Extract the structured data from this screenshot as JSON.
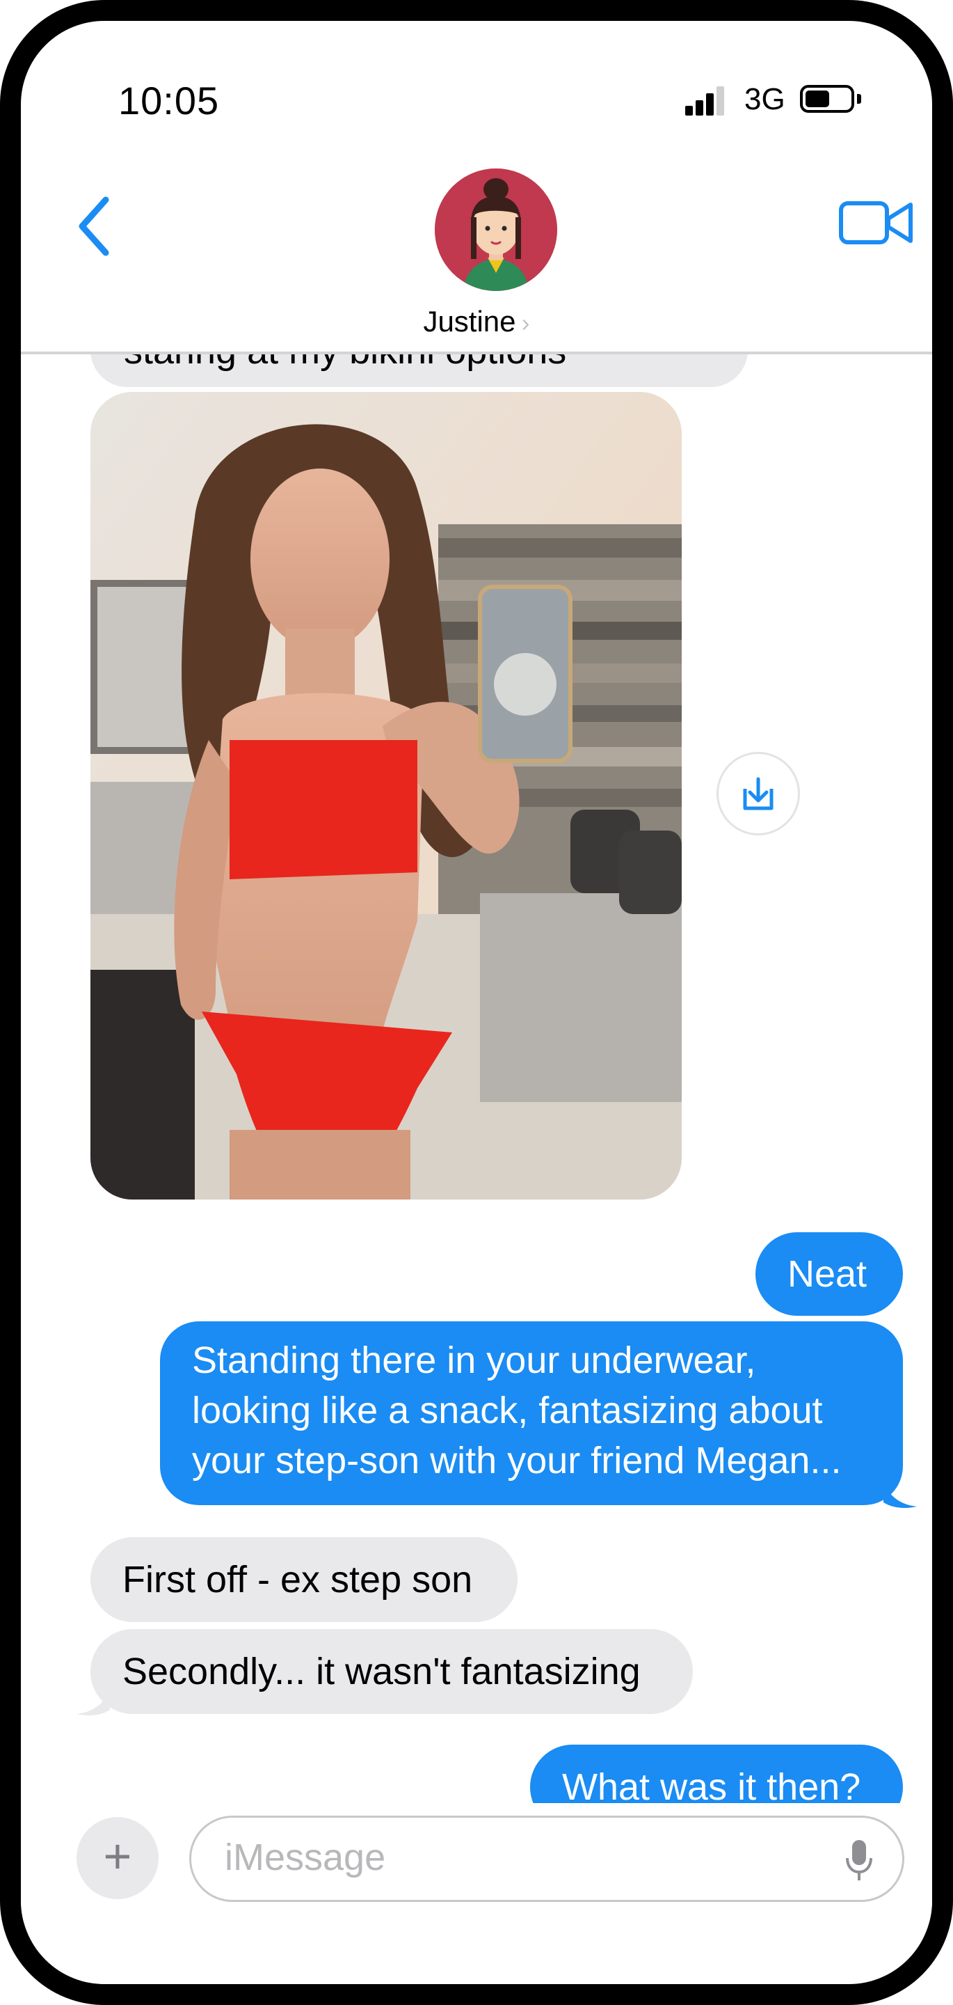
{
  "status_bar": {
    "time": "10:05",
    "network": "3G"
  },
  "header": {
    "contact_name": "Justine",
    "chevron": "›"
  },
  "messages": [
    {
      "from": "them",
      "kind": "text",
      "text": "staring at my bikini options"
    },
    {
      "from": "them",
      "kind": "photo"
    },
    {
      "from": "me",
      "kind": "text",
      "text": "Neat"
    },
    {
      "from": "me",
      "kind": "text",
      "lines": [
        "Standing there in your underwear,",
        "looking like a snack, fantasizing about",
        "your step-son with your friend Megan..."
      ]
    },
    {
      "from": "them",
      "kind": "text",
      "text": "First off - ex step son"
    },
    {
      "from": "them",
      "kind": "text",
      "text": "Secondly... it wasn't fantasizing"
    },
    {
      "from": "me",
      "kind": "text",
      "text": "What was it then?"
    }
  ],
  "composer": {
    "placeholder": "iMessage",
    "plus": "+"
  },
  "icons": {
    "back": "chevron-left-icon",
    "video": "video-camera-icon",
    "save": "save-photo-icon",
    "mic": "microphone-icon"
  },
  "colors": {
    "accent": "#1a8cf3",
    "incoming_bubble": "#e9e9eb",
    "frame": "#000000"
  }
}
